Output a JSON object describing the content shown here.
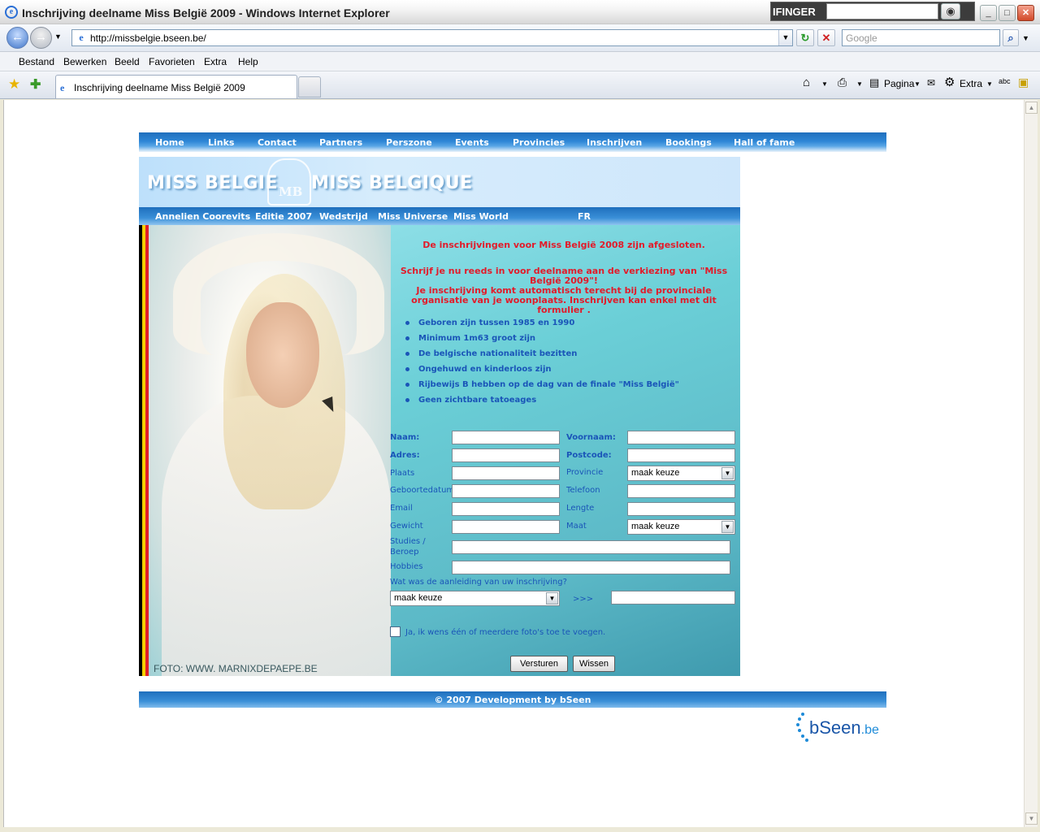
{
  "window": {
    "title": "Inschrijving deelname Miss België 2009 - Windows Internet Explorer",
    "ifinger_label": "IFINGER"
  },
  "address_bar": {
    "url": "http://missbelgie.bseen.be/",
    "search_placeholder": "Google"
  },
  "menu": [
    "Bestand",
    "Bewerken",
    "Beeld",
    "Favorieten",
    "Extra",
    "Help"
  ],
  "tab": {
    "title": "Inschrijving deelname Miss België 2009"
  },
  "command_bar": {
    "page_label": "Pagina",
    "extra_label": "Extra"
  },
  "site": {
    "top_nav": [
      "Home",
      "Links",
      "Contact",
      "Partners",
      "Perszone",
      "Events",
      "Provincies",
      "Inschrijven",
      "Bookings",
      "Hall of fame"
    ],
    "banner": {
      "left": "MISS BELGIE",
      "right": "MISS BELGIQUE",
      "monogram": "MB"
    },
    "sub_nav": [
      "Annelien Coorevits",
      "Editie 2007",
      "Wedstrijd",
      "Miss Universe",
      "Miss World",
      "FR"
    ],
    "notice_closed": "De inschrijvingen voor Miss België 2008 zijn afgesloten.",
    "notice_signup": "Schrijf je nu reeds in voor deelname aan de verkiezing van \"Miss België 2009\"!",
    "notice_auto": "Je inschrijving komt automatisch terecht bij de provinciale organisatie van je woonplaats. Inschrijven kan enkel met dit formulier .",
    "requirements": [
      "Geboren zijn tussen 1985 en 1990",
      "Minimum 1m63 groot zijn",
      "De belgische nationaliteit bezitten",
      "Ongehuwd en kinderloos zijn",
      "Rijbewijs B hebben op de dag van de finale \"Miss België\"",
      "Geen zichtbare tatoeages"
    ],
    "form": {
      "naam": "Naam:",
      "voornaam": "Voornaam:",
      "adres": "Adres:",
      "postcode": "Postcode:",
      "plaats": "Plaats",
      "provincie": "Provincie",
      "provincie_value": "maak keuze",
      "geboortedatum": "Geboortedatum",
      "telefoon": "Telefoon",
      "email": "Email",
      "lengte": "Lengte",
      "gewicht": "Gewicht",
      "maat": "Maat",
      "maat_value": "maak keuze",
      "studies_1": "Studies /",
      "studies_2": "Beroep",
      "hobbies": "Hobbies",
      "aanleiding": "Wat was de aanleiding van uw inschrijving?",
      "aanleiding_value": "maak keuze",
      "arrow": ">>>",
      "photos": "Ja, ik wens één of meerdere foto's toe te voegen.",
      "submit": "Versturen",
      "reset": "Wissen"
    },
    "photo_credit": "FOTO: WWW. MARNIXDEPAEPE.BE",
    "footer": "© 2007 Development by bSeen",
    "logo_main": "bSeen",
    "logo_tld": ".be"
  },
  "colors": {
    "nav_blue": "#2d86d6",
    "notice_red": "#e21b2a",
    "label_blue": "#1a55b8",
    "flag_black": "#000000",
    "flag_yellow": "#f5d000",
    "flag_red": "#e0202a"
  }
}
